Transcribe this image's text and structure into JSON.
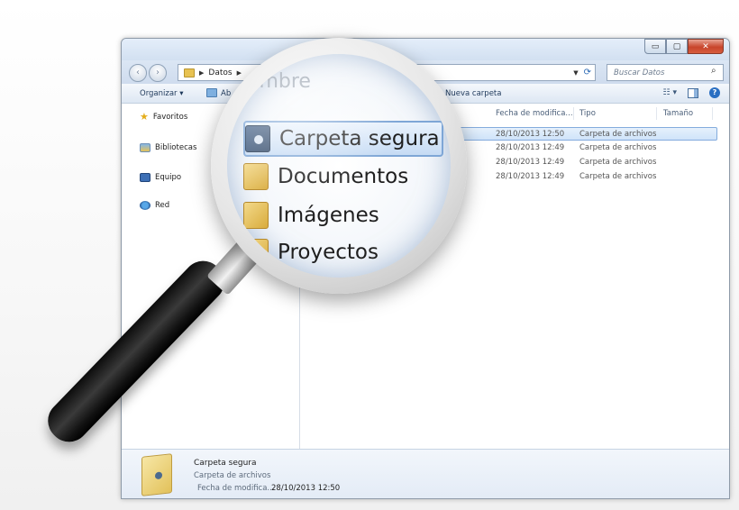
{
  "window": {
    "caption_buttons": [
      "minimize-icon",
      "maximize-icon",
      "close-icon"
    ],
    "caption_glyphs": {
      "minimize": "▭",
      "maximize": "▢",
      "close": "✕"
    }
  },
  "navigation": {
    "back_icon": "back-arrow-icon",
    "forward_icon": "forward-arrow-icon",
    "address_path": [
      "Datos"
    ],
    "search_placeholder": "Buscar Datos"
  },
  "toolbar": {
    "organize_label": "Organizar ▾",
    "open_label": "Ab",
    "new_folder_label": "Nueva carpeta"
  },
  "sidebar": {
    "items": [
      {
        "label": "Favoritos",
        "icon": "star-icon"
      },
      {
        "label": "Bibliotecas",
        "icon": "libraries-icon"
      },
      {
        "label": "Equipo",
        "icon": "computer-icon"
      },
      {
        "label": "Red",
        "icon": "network-icon"
      }
    ]
  },
  "file_list": {
    "columns": {
      "date": "Fecha de modifica...",
      "type": "Tipo",
      "size": "Tamaño"
    },
    "rows": [
      {
        "name": "Carpeta segura",
        "date": "28/10/2013 12:50",
        "type": "Carpeta de archivos",
        "selected": true
      },
      {
        "name": "Documentos",
        "date": "28/10/2013 12:49",
        "type": "Carpeta de archivos",
        "selected": false
      },
      {
        "name": "Imágenes",
        "date": "28/10/2013 12:49",
        "type": "Carpeta de archivos",
        "selected": false
      },
      {
        "name": "Proyectos",
        "date": "28/10/2013 12:49",
        "type": "Carpeta de archivos",
        "selected": false
      }
    ]
  },
  "magnifier": {
    "header_text": "ombre",
    "items": [
      "Carpeta segura",
      "Documentos",
      "Imágenes",
      "Proyectos"
    ]
  },
  "details": {
    "title": "Carpeta segura",
    "subtitle": "Carpeta de archivos",
    "date_label": "Fecha de modifica...",
    "date_value": "28/10/2013 12:50"
  },
  "colors": {
    "selection": "#cfe3f9",
    "folder": "#e2c15a",
    "accent": "#2a6fc2"
  }
}
